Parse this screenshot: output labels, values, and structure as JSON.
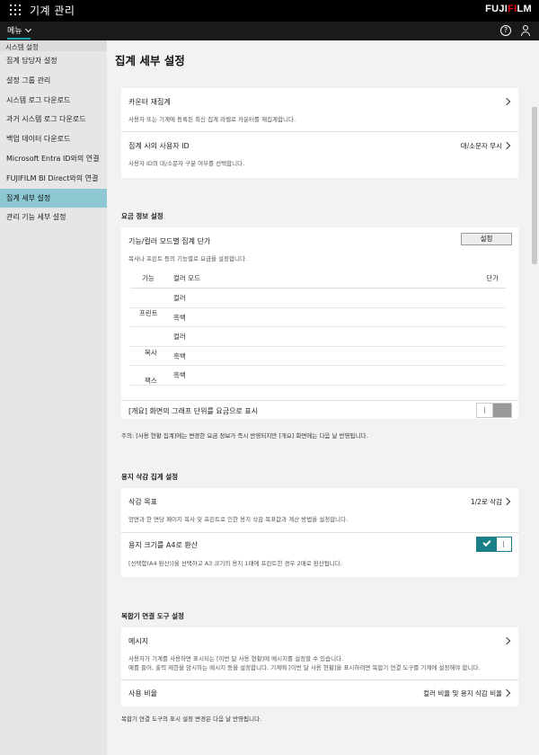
{
  "header": {
    "app_title": "기계 관리",
    "brand_main": "FUJIFILM",
    "menu_label": "메뉴"
  },
  "sidebar": {
    "group_label": "시스템 설정",
    "items": [
      {
        "label": "집계 담당자 설정"
      },
      {
        "label": "설정 그룹 관리"
      },
      {
        "label": "시스템 로그 다운로드"
      },
      {
        "label": "과거 시스템 로그 다운로드"
      },
      {
        "label": "백업 데이터 다운로드"
      },
      {
        "label": "Microsoft Entra ID와의 연결"
      },
      {
        "label": "FUJIFILM BI Direct와의 연결"
      },
      {
        "label": "집계 세부 설정",
        "active": true
      },
      {
        "label": "관리 기능 세부 설정"
      }
    ]
  },
  "main": {
    "title": "집계 세부 설정",
    "counter_card": {
      "recount_title": "카운터 재집계",
      "recount_desc": "사용자 또는 기계에 등록된 최신 집계 라벨로 카운터를 재집계합니다.",
      "userid_title": "집계 시의 사용자 ID",
      "userid_desc": "사용자 ID의 대/소문자 구분 여부를 선택합니다.",
      "userid_value": "대/소문자 무시"
    },
    "fee_section": {
      "title": "요금 정보 설정",
      "row_title": "기능/컬러 모드별 집계 단가",
      "row_desc": "복사나 프린트 등의 기능별로 요금을 설정합니다.",
      "button_label": "설정",
      "table": {
        "headers": {
          "function": "기능",
          "mode": "컬러 모드",
          "price": "단가"
        },
        "groups": [
          {
            "function": "프린트",
            "modes": [
              "컬러",
              "흑백"
            ]
          },
          {
            "function": "복사",
            "modes": [
              "컬러",
              "흑백"
            ]
          },
          {
            "function": "팩스",
            "modes": [
              "흑백"
            ]
          }
        ]
      },
      "graph_toggle_label": "[개요] 화면의 그래프 단위를 요금으로 표시",
      "graph_toggle_on": false,
      "note": "주의: [사용 현황 집계]에는 변경한 요금 정보가 즉시 반영되지만 [개요] 화면에는 다음 날 반영됩니다."
    },
    "paper_section": {
      "title": "용지 삭감 집계 설정",
      "target_title": "삭감 목표",
      "target_desc": "양면과 한 면당 페이지 복사 및 프린트로 인한 용지 삭감 목표값과 계산 방법을 설정합니다.",
      "target_value": "1/2로 삭감",
      "a4_title": "용지 크기를 A4로 환산",
      "a4_desc": "[선택함(A4 환산)]을 선택하고 A3 크기의 용지 1매에 프린트한 경우 2매로 환산됩니다.",
      "a4_toggle_on": true
    },
    "mfp_section": {
      "title": "복합기 연결 도구 설정",
      "message_title": "메시지",
      "message_desc_1": "사용자가 기계를 사용하면 표시되는 [이번 달 사용 현황]에 메시지를 설정할 수 있습니다.",
      "message_desc_2": "예를 들어, 출력 제한을 암시하는 메시지 등을 설정합니다. 기계에 [이번 달 사용 현황]을 표시하려면 복합기 연결 도구를 기계에 설정해야 합니다.",
      "ratio_title": "사용 비율",
      "ratio_value": "컬러 비율 및 용지 삭감 비율",
      "note": "복합기 연결 도구의 표시 설정 변경은 다음 날 반영됩니다."
    }
  }
}
